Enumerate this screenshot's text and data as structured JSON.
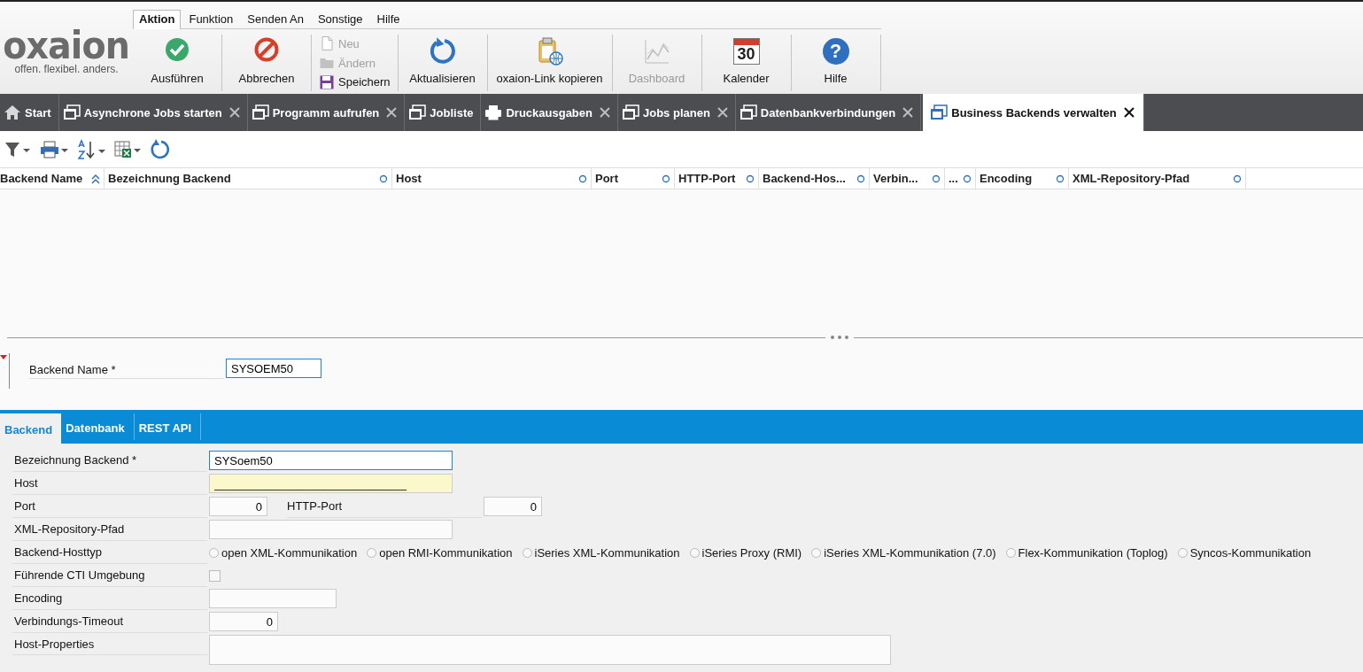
{
  "ribbon": {
    "logo": {
      "wordmark": "oxaion",
      "tagline": "offen. flexibel. anders."
    },
    "menu": [
      {
        "label": "Aktion",
        "selected": true
      },
      {
        "label": "Funktion",
        "selected": false
      },
      {
        "label": "Senden An",
        "selected": false
      },
      {
        "label": "Sonstige",
        "selected": false
      },
      {
        "label": "Hilfe",
        "selected": false
      }
    ],
    "groups": [
      {
        "kind": "large",
        "buttons": [
          {
            "label": "Ausführen",
            "disabled": false
          }
        ]
      },
      {
        "kind": "large",
        "buttons": [
          {
            "label": "Abbrechen",
            "disabled": false
          }
        ]
      },
      {
        "kind": "stack",
        "buttons": [
          {
            "label": "Neu",
            "disabled": true
          },
          {
            "label": "Ändern",
            "disabled": true
          },
          {
            "label": "Speichern",
            "disabled": false
          }
        ]
      },
      {
        "kind": "large",
        "buttons": [
          {
            "label": "Aktualisieren",
            "disabled": false
          }
        ]
      },
      {
        "kind": "large",
        "buttons": [
          {
            "label": "oxaion-Link kopieren",
            "disabled": false
          }
        ]
      },
      {
        "kind": "large",
        "buttons": [
          {
            "label": "Dashboard",
            "disabled": true
          }
        ]
      },
      {
        "kind": "large",
        "buttons": [
          {
            "label": "Kalender",
            "icon_text": "30",
            "disabled": false
          }
        ]
      },
      {
        "kind": "large",
        "buttons": [
          {
            "label": "Hilfe",
            "icon_text": "?",
            "disabled": false
          }
        ]
      }
    ]
  },
  "document_tabs": [
    {
      "label": "Start",
      "kind": "home",
      "closable": false,
      "selected": false
    },
    {
      "label": "Asynchrone Jobs starten",
      "kind": "window",
      "closable": true,
      "selected": false
    },
    {
      "label": "Programm aufrufen",
      "kind": "window",
      "closable": true,
      "selected": false
    },
    {
      "label": "Jobliste",
      "kind": "window",
      "closable": false,
      "selected": false
    },
    {
      "label": "Druckausgaben",
      "kind": "printer",
      "closable": true,
      "selected": false
    },
    {
      "label": "Jobs planen",
      "kind": "window",
      "closable": true,
      "selected": false
    },
    {
      "label": "Datenbankverbindungen",
      "kind": "window",
      "closable": true,
      "selected": false
    },
    {
      "label": "Business Backends verwalten",
      "kind": "window",
      "closable": true,
      "selected": true
    }
  ],
  "table": {
    "columns": [
      {
        "label": "Backend Name",
        "sorted": true
      },
      {
        "label": "Bezeichnung Backend",
        "sorted": false
      },
      {
        "label": "Host",
        "sorted": false
      },
      {
        "label": "Port",
        "sorted": false
      },
      {
        "label": "HTTP-Port",
        "sorted": false
      },
      {
        "label": "Backend-Hos...",
        "sorted": false
      },
      {
        "label": "Verbin...",
        "sorted": false
      },
      {
        "label": "...",
        "sorted": false
      },
      {
        "label": "Encoding",
        "sorted": false
      },
      {
        "label": "XML-Repository-Pfad",
        "sorted": false
      }
    ]
  },
  "detail": {
    "label": "Backend Name *",
    "value": "SYSOEM50"
  },
  "sub_tabs": [
    {
      "label": "Backend",
      "selected": true
    },
    {
      "label": "Datenbank",
      "selected": false
    },
    {
      "label": "REST API",
      "selected": false
    }
  ],
  "form": [
    {
      "label": "Bezeichnung Backend *",
      "kind": "text",
      "value": "SYSoem50",
      "focused": true
    },
    {
      "label": "Host",
      "kind": "text",
      "value": "______________________________",
      "focused": false,
      "highlighted": true
    },
    {
      "label": "Port",
      "kind": "pair",
      "value": "0",
      "second_label": "HTTP-Port",
      "second_value": "0"
    },
    {
      "label": "XML-Repository-Pfad",
      "kind": "text",
      "focused": false,
      "highlighted": false
    },
    {
      "label": "Backend-Hosttyp",
      "kind": "radio",
      "options": [
        {
          "label": "open XML-Kommunikation",
          "selected": false
        },
        {
          "label": "open RMI-Kommunikation",
          "selected": false
        },
        {
          "label": "iSeries XML-Kommunikation",
          "selected": false
        },
        {
          "label": "iSeries Proxy (RMI)",
          "selected": false
        },
        {
          "label": "iSeries XML-Kommunikation (7.0)",
          "selected": false
        },
        {
          "label": "Flex-Kommunikation (Toplog)",
          "selected": false
        },
        {
          "label": "Syncos-Kommunikation",
          "selected": false
        }
      ]
    },
    {
      "label": "Führende CTI Umgebung",
      "kind": "checkbox",
      "checked": false
    },
    {
      "label": "Encoding",
      "kind": "short"
    },
    {
      "label": "Verbindungs-Timeout",
      "kind": "number",
      "value": "0"
    },
    {
      "label": "Host-Properties",
      "kind": "textarea"
    }
  ]
}
